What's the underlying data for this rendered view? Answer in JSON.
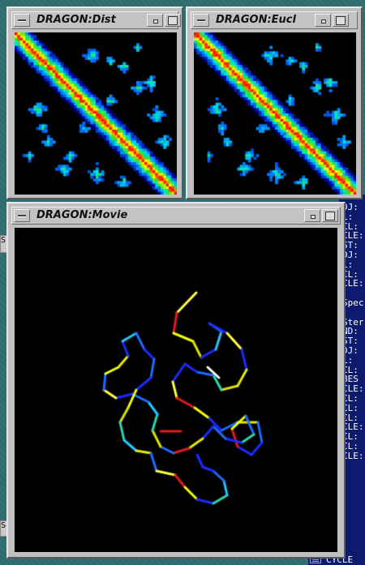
{
  "windows": {
    "dist": {
      "title": "DRAGON:Dist"
    },
    "eucl": {
      "title": "DRAGON:Eucl"
    },
    "movie": {
      "title": "DRAGON:Movie"
    }
  },
  "terminal": {
    "lines": [
      "DJ:",
      "L:",
      "CL:",
      "CLE:",
      "ST:",
      "DJ:",
      "L:",
      "CL:",
      "CLE:",
      "",
      "Spec",
      "",
      "Ster",
      "ND:",
      "ST:",
      "DJ:",
      "L:",
      "CL:",
      "BES",
      "CLE:",
      "CL:",
      "CL:",
      "CL:",
      "CLE:",
      "CL:",
      "CL:",
      "CLE:"
    ],
    "bottom_text": "CYCLE"
  },
  "desktop_fragments": {
    "left_top": "S",
    "left_bottom": "S4"
  },
  "colors": {
    "desktop": "#2e6b6e",
    "window_frame": "#c0c0c0",
    "terminal_bg": "#0d1b6e",
    "matrix_low": "#0000a0",
    "matrix_high": "#ff0000"
  }
}
